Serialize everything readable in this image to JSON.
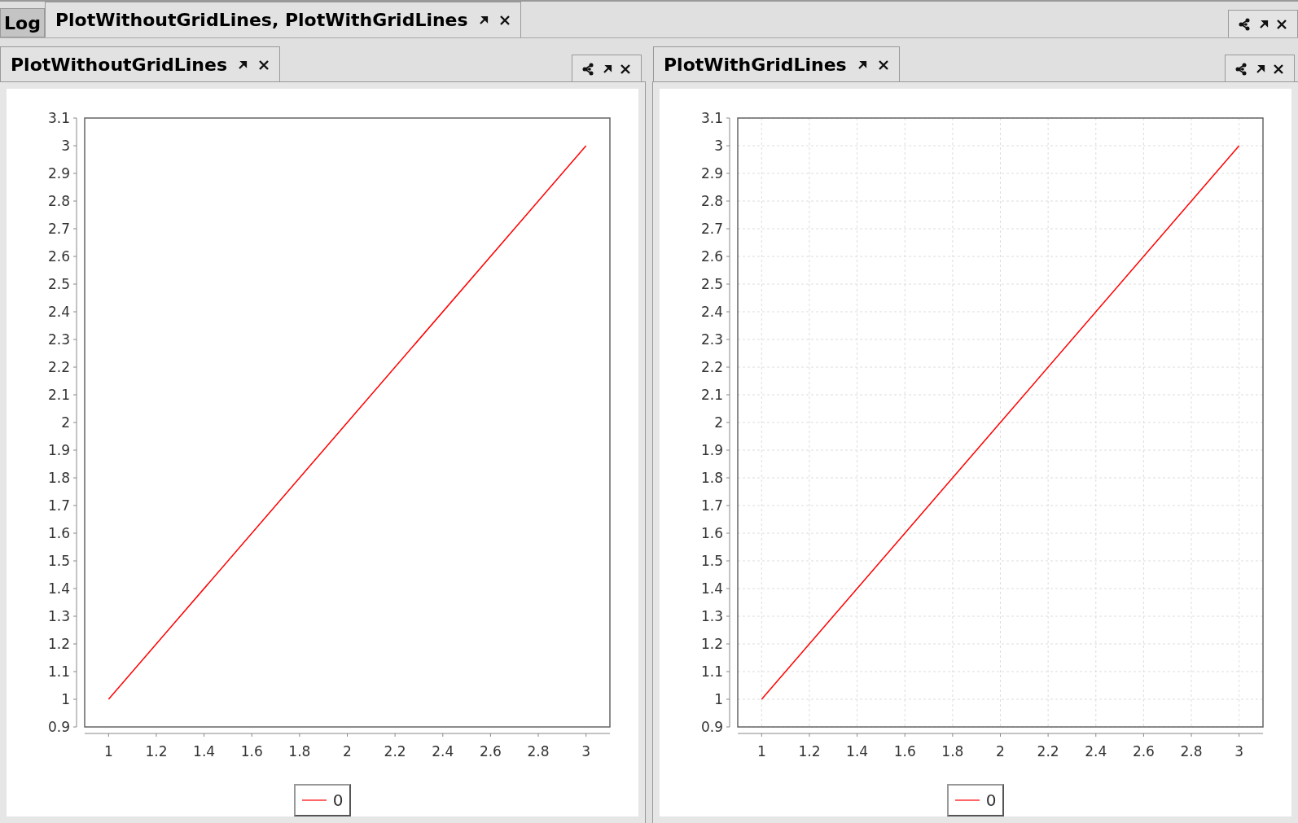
{
  "main_tabs": [
    {
      "label": "Log",
      "selected": false
    },
    {
      "label": "PlotWithoutGridLines, PlotWithGridLines",
      "selected": true
    }
  ],
  "panels": [
    {
      "tab": "PlotWithoutGridLines",
      "chart_data": {
        "type": "line",
        "grid": false,
        "x": [
          1,
          2,
          3
        ],
        "series": [
          {
            "name": "0",
            "color": "#ff0000",
            "values": [
              1,
              2,
              3
            ]
          }
        ],
        "xlim": [
          0.9,
          3.1
        ],
        "ylim": [
          0.9,
          3.1
        ],
        "xticks": [
          1,
          1.2,
          1.4,
          1.6,
          1.8,
          2,
          2.2,
          2.4,
          2.6,
          2.8,
          3
        ],
        "yticks": [
          0.9,
          1,
          1.1,
          1.2,
          1.3,
          1.4,
          1.5,
          1.6,
          1.7,
          1.8,
          1.9,
          2,
          2.1,
          2.2,
          2.3,
          2.4,
          2.5,
          2.6,
          2.7,
          2.8,
          2.9,
          3,
          3.1
        ]
      }
    },
    {
      "tab": "PlotWithGridLines",
      "chart_data": {
        "type": "line",
        "grid": true,
        "x": [
          1,
          2,
          3
        ],
        "series": [
          {
            "name": "0",
            "color": "#ff0000",
            "values": [
              1,
              2,
              3
            ]
          }
        ],
        "xlim": [
          0.9,
          3.1
        ],
        "ylim": [
          0.9,
          3.1
        ],
        "xticks": [
          1,
          1.2,
          1.4,
          1.6,
          1.8,
          2,
          2.2,
          2.4,
          2.6,
          2.8,
          3
        ],
        "yticks": [
          0.9,
          1,
          1.1,
          1.2,
          1.3,
          1.4,
          1.5,
          1.6,
          1.7,
          1.8,
          1.9,
          2,
          2.1,
          2.2,
          2.3,
          2.4,
          2.5,
          2.6,
          2.7,
          2.8,
          2.9,
          3,
          3.1
        ]
      }
    }
  ]
}
